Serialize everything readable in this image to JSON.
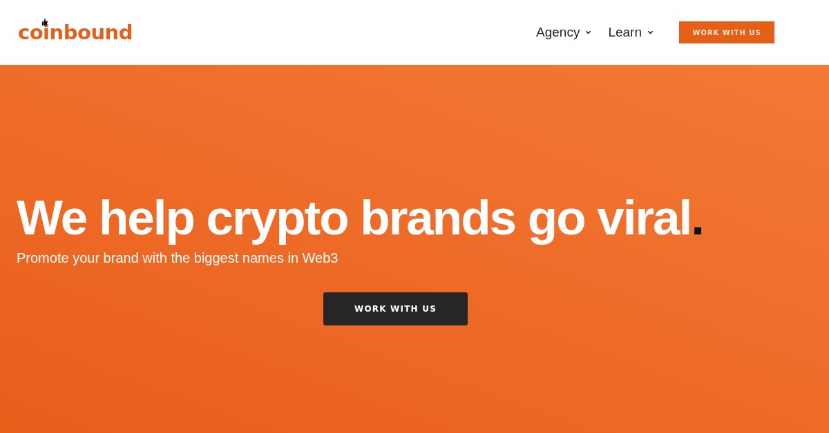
{
  "header": {
    "logo": "coinbound",
    "nav": [
      {
        "label": "Agency",
        "has_dropdown": true
      },
      {
        "label": "Learn",
        "has_dropdown": true
      }
    ],
    "cta": "WORK WITH US"
  },
  "hero": {
    "headline": "We help crypto brands go viral",
    "headline_accent": ".",
    "subtitle": "Promote your brand with the biggest names in Web3",
    "cta": "WORK WITH US"
  }
}
